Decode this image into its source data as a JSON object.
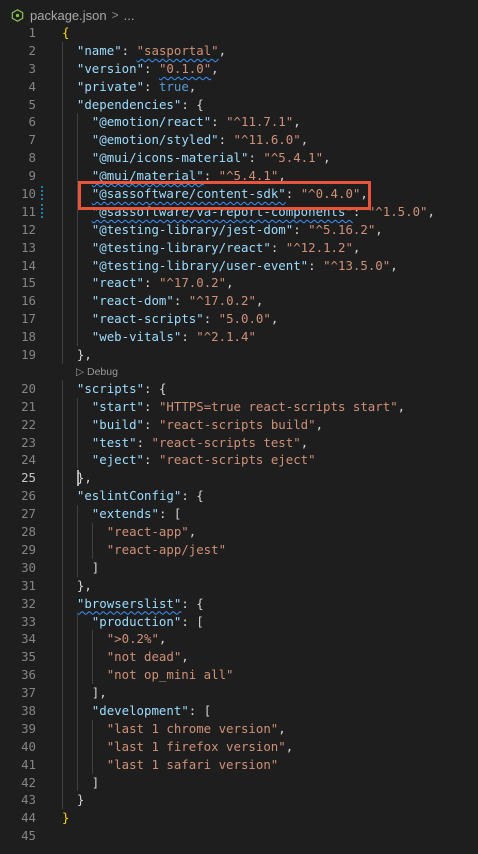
{
  "breadcrumb": {
    "file": "package.json",
    "separator": ">",
    "more": "..."
  },
  "codelens": {
    "label": "▷ Debug"
  },
  "colors": {
    "highlight_box": "#e8553a",
    "key": "#9cdcfe",
    "string": "#ce9178",
    "boolean": "#569cd6"
  },
  "lines": [
    {
      "n": "1",
      "t": [
        [
          "br",
          "{"
        ]
      ]
    },
    {
      "n": "2",
      "t": [
        [
          "k",
          "\"name\""
        ],
        [
          "p",
          ": "
        ],
        [
          "s",
          "\"sasportal\"",
          "sq"
        ],
        [
          "p",
          ","
        ]
      ]
    },
    {
      "n": "3",
      "t": [
        [
          "k",
          "\"version\""
        ],
        [
          "p",
          ": "
        ],
        [
          "s",
          "\"0.1.0\"",
          "sq"
        ],
        [
          "p",
          ","
        ]
      ]
    },
    {
      "n": "4",
      "t": [
        [
          "k",
          "\"private\""
        ],
        [
          "p",
          ": "
        ],
        [
          "b",
          "true"
        ],
        [
          "p",
          ","
        ]
      ]
    },
    {
      "n": "5",
      "t": [
        [
          "k",
          "\"dependencies\""
        ],
        [
          "p",
          ": {"
        ]
      ]
    },
    {
      "n": "6",
      "t": [
        [
          "k",
          "\"@emotion/react\""
        ],
        [
          "p",
          ": "
        ],
        [
          "s",
          "\"^11.7.1\""
        ],
        [
          "p",
          ","
        ]
      ]
    },
    {
      "n": "7",
      "t": [
        [
          "k",
          "\"@emotion/styled\""
        ],
        [
          "p",
          ": "
        ],
        [
          "s",
          "\"^11.6.0\""
        ],
        [
          "p",
          ","
        ]
      ]
    },
    {
      "n": "8",
      "t": [
        [
          "k",
          "\"@mui/icons-material\""
        ],
        [
          "p",
          ": "
        ],
        [
          "s",
          "\"^5.4.1\""
        ],
        [
          "p",
          ","
        ]
      ]
    },
    {
      "n": "9",
      "t": [
        [
          "k",
          "\"@mui/material\"",
          "sq"
        ],
        [
          "p",
          ": "
        ],
        [
          "s",
          "\"^5.4.1\""
        ],
        [
          "p",
          ","
        ]
      ]
    },
    {
      "n": "10",
      "t": [
        [
          "k",
          "\"@sassoftware/content-sdk\"",
          "sq"
        ],
        [
          "p",
          ": "
        ],
        [
          "s",
          "\"^0.4.0\""
        ],
        [
          "p",
          ","
        ]
      ]
    },
    {
      "n": "11",
      "t": [
        [
          "k",
          "\"@sassoftware/va-report-components\"",
          "sq"
        ],
        [
          "p",
          ": "
        ],
        [
          "s",
          "\"^1.5.0\""
        ],
        [
          "p",
          ","
        ]
      ]
    },
    {
      "n": "12",
      "t": [
        [
          "k",
          "\"@testing-library/jest-dom\""
        ],
        [
          "p",
          ": "
        ],
        [
          "s",
          "\"^5.16.2\""
        ],
        [
          "p",
          ","
        ]
      ]
    },
    {
      "n": "13",
      "t": [
        [
          "k",
          "\"@testing-library/react\""
        ],
        [
          "p",
          ": "
        ],
        [
          "s",
          "\"^12.1.2\""
        ],
        [
          "p",
          ","
        ]
      ]
    },
    {
      "n": "14",
      "t": [
        [
          "k",
          "\"@testing-library/user-event\""
        ],
        [
          "p",
          ": "
        ],
        [
          "s",
          "\"^13.5.0\""
        ],
        [
          "p",
          ","
        ]
      ]
    },
    {
      "n": "15",
      "t": [
        [
          "k",
          "\"react\""
        ],
        [
          "p",
          ": "
        ],
        [
          "s",
          "\"^17.0.2\""
        ],
        [
          "p",
          ","
        ]
      ]
    },
    {
      "n": "16",
      "t": [
        [
          "k",
          "\"react-dom\""
        ],
        [
          "p",
          ": "
        ],
        [
          "s",
          "\"^17.0.2\""
        ],
        [
          "p",
          ","
        ]
      ]
    },
    {
      "n": "17",
      "t": [
        [
          "k",
          "\"react-scripts\""
        ],
        [
          "p",
          ": "
        ],
        [
          "s",
          "\"5.0.0\""
        ],
        [
          "p",
          ","
        ]
      ]
    },
    {
      "n": "18",
      "t": [
        [
          "k",
          "\"web-vitals\""
        ],
        [
          "p",
          ": "
        ],
        [
          "s",
          "\"^2.1.4\""
        ]
      ]
    },
    {
      "n": "19",
      "t": [
        [
          "p",
          "},"
        ]
      ]
    },
    {
      "n": "20",
      "t": [
        [
          "k",
          "\"scripts\""
        ],
        [
          "p",
          ": {"
        ]
      ]
    },
    {
      "n": "21",
      "t": [
        [
          "k",
          "\"start\""
        ],
        [
          "p",
          ": "
        ],
        [
          "s",
          "\"HTTPS=true react-scripts start\""
        ],
        [
          "p",
          ","
        ]
      ]
    },
    {
      "n": "22",
      "t": [
        [
          "k",
          "\"build\""
        ],
        [
          "p",
          ": "
        ],
        [
          "s",
          "\"react-scripts build\""
        ],
        [
          "p",
          ","
        ]
      ]
    },
    {
      "n": "23",
      "t": [
        [
          "k",
          "\"test\""
        ],
        [
          "p",
          ": "
        ],
        [
          "s",
          "\"react-scripts test\""
        ],
        [
          "p",
          ","
        ]
      ]
    },
    {
      "n": "24",
      "t": [
        [
          "k",
          "\"eject\""
        ],
        [
          "p",
          ": "
        ],
        [
          "s",
          "\"react-scripts eject\""
        ]
      ]
    },
    {
      "n": "25",
      "t": [
        [
          "p",
          "},"
        ]
      ]
    },
    {
      "n": "26",
      "t": [
        [
          "k",
          "\"eslintConfig\""
        ],
        [
          "p",
          ": {"
        ]
      ]
    },
    {
      "n": "27",
      "t": [
        [
          "k",
          "\"extends\""
        ],
        [
          "p",
          ": ["
        ]
      ]
    },
    {
      "n": "28",
      "t": [
        [
          "s",
          "\"react-app\""
        ],
        [
          "p",
          ","
        ]
      ]
    },
    {
      "n": "29",
      "t": [
        [
          "s",
          "\"react-app/jest\""
        ]
      ]
    },
    {
      "n": "30",
      "t": [
        [
          "p",
          "]"
        ]
      ]
    },
    {
      "n": "31",
      "t": [
        [
          "p",
          "},"
        ]
      ]
    },
    {
      "n": "32",
      "t": [
        [
          "k",
          "\"browserslist\"",
          "sq"
        ],
        [
          "p",
          ": {"
        ]
      ]
    },
    {
      "n": "33",
      "t": [
        [
          "k",
          "\"production\""
        ],
        [
          "p",
          ": ["
        ]
      ]
    },
    {
      "n": "34",
      "t": [
        [
          "s",
          "\">0.2%\""
        ],
        [
          "p",
          ","
        ]
      ]
    },
    {
      "n": "35",
      "t": [
        [
          "s",
          "\"not dead\""
        ],
        [
          "p",
          ","
        ]
      ]
    },
    {
      "n": "36",
      "t": [
        [
          "s",
          "\"not op_mini all\""
        ]
      ]
    },
    {
      "n": "37",
      "t": [
        [
          "p",
          "],"
        ]
      ]
    },
    {
      "n": "38",
      "t": [
        [
          "k",
          "\"development\""
        ],
        [
          "p",
          ": ["
        ]
      ]
    },
    {
      "n": "39",
      "t": [
        [
          "s",
          "\"last 1 chrome version\""
        ],
        [
          "p",
          ","
        ]
      ]
    },
    {
      "n": "40",
      "t": [
        [
          "s",
          "\"last 1 firefox version\""
        ],
        [
          "p",
          ","
        ]
      ]
    },
    {
      "n": "41",
      "t": [
        [
          "s",
          "\"last 1 safari version\""
        ]
      ]
    },
    {
      "n": "42",
      "t": [
        [
          "p",
          "]"
        ]
      ]
    },
    {
      "n": "43",
      "t": [
        [
          "p",
          "}"
        ]
      ]
    },
    {
      "n": "44",
      "t": [
        [
          "br",
          "}"
        ]
      ]
    },
    {
      "n": "45",
      "t": []
    }
  ]
}
